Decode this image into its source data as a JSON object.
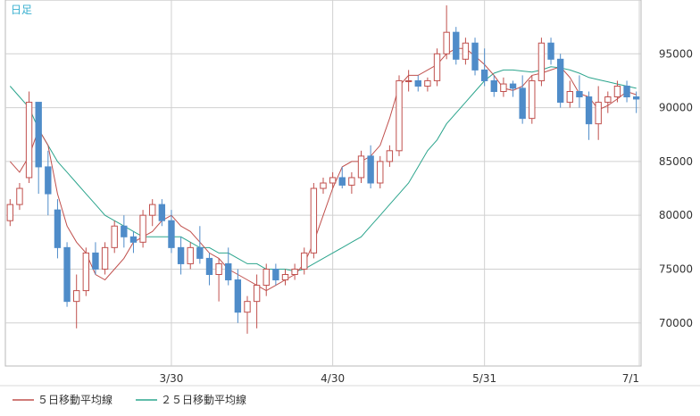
{
  "chart_data": {
    "type": "candlestick",
    "period_label": "日足",
    "legend": [
      {
        "label": "５日移動平均線",
        "color": "#c0504d"
      },
      {
        "label": "２５日移動平均線",
        "color": "#2ca58d"
      }
    ],
    "x_ticks": [
      "3/30",
      "4/30",
      "5/31",
      "7/1"
    ],
    "y_ticks": [
      70000,
      75000,
      80000,
      85000,
      90000,
      95000
    ],
    "ylim": [
      66000,
      100000
    ],
    "colors": {
      "up": "#c0504d",
      "down": "#4f8cc9",
      "ma5": "#c0504d",
      "ma25": "#2ca58d",
      "grid": "#d0d0d0",
      "axis_text": "#333333",
      "title": "#3ab0d0"
    },
    "candles": [
      [
        79500,
        81500,
        79000,
        81000
      ],
      [
        81000,
        83000,
        80500,
        82500
      ],
      [
        83500,
        91500,
        83000,
        90500
      ],
      [
        90500,
        90500,
        82000,
        84500
      ],
      [
        84500,
        86000,
        80000,
        82000
      ],
      [
        80500,
        81500,
        76000,
        77000
      ],
      [
        77000,
        77500,
        71500,
        72000
      ],
      [
        72000,
        74500,
        69500,
        73000
      ],
      [
        73000,
        77000,
        72500,
        76500
      ],
      [
        76500,
        77500,
        74500,
        75000
      ],
      [
        75000,
        77500,
        74500,
        77000
      ],
      [
        77000,
        79500,
        76500,
        79000
      ],
      [
        79000,
        80000,
        77000,
        78000
      ],
      [
        78000,
        78500,
        76500,
        77500
      ],
      [
        77500,
        80500,
        77000,
        80000
      ],
      [
        80000,
        81500,
        79000,
        81000
      ],
      [
        81000,
        81500,
        79000,
        79500
      ],
      [
        79500,
        80500,
        76500,
        77000
      ],
      [
        77000,
        78000,
        74500,
        75500
      ],
      [
        75500,
        77500,
        75000,
        77000
      ],
      [
        77000,
        79000,
        75500,
        76000
      ],
      [
        76000,
        76500,
        73500,
        74500
      ],
      [
        74500,
        76000,
        72000,
        75500
      ],
      [
        75500,
        77000,
        73500,
        74000
      ],
      [
        74000,
        75000,
        70000,
        71000
      ],
      [
        71000,
        72500,
        69000,
        72000
      ],
      [
        72000,
        74500,
        69500,
        73500
      ],
      [
        73500,
        75500,
        72500,
        75000
      ],
      [
        75000,
        75500,
        73500,
        74000
      ],
      [
        74000,
        75000,
        73500,
        74500
      ],
      [
        74500,
        75500,
        74000,
        75000
      ],
      [
        75000,
        77000,
        74500,
        76500
      ],
      [
        76500,
        83000,
        76000,
        82500
      ],
      [
        82500,
        83500,
        82000,
        83000
      ],
      [
        83000,
        84000,
        82500,
        83500
      ],
      [
        83500,
        84500,
        82500,
        82800
      ],
      [
        82800,
        84000,
        82000,
        83500
      ],
      [
        83500,
        86000,
        83000,
        85500
      ],
      [
        85500,
        86500,
        82500,
        83000
      ],
      [
        83000,
        85500,
        82500,
        85000
      ],
      [
        85000,
        86500,
        84500,
        86000
      ],
      [
        86000,
        93000,
        85500,
        92500
      ],
      [
        92500,
        93500,
        91500,
        92500
      ],
      [
        92500,
        93000,
        91500,
        92000
      ],
      [
        92000,
        92800,
        91500,
        92500
      ],
      [
        92500,
        95500,
        92000,
        95000
      ],
      [
        95000,
        99500,
        94500,
        97000
      ],
      [
        97000,
        97500,
        94000,
        94500
      ],
      [
        94500,
        96500,
        94000,
        96000
      ],
      [
        96000,
        96500,
        93000,
        93500
      ],
      [
        93500,
        95500,
        92000,
        92500
      ],
      [
        92500,
        93000,
        91000,
        91500
      ],
      [
        91500,
        92800,
        91000,
        92200
      ],
      [
        92200,
        92500,
        91000,
        91800
      ],
      [
        91800,
        93000,
        88500,
        89000
      ],
      [
        89000,
        93000,
        88500,
        92500
      ],
      [
        92500,
        96500,
        92000,
        96000
      ],
      [
        96000,
        96500,
        94000,
        94500
      ],
      [
        94500,
        95000,
        90000,
        90500
      ],
      [
        90500,
        92500,
        90000,
        91500
      ],
      [
        91500,
        93000,
        90000,
        91000
      ],
      [
        91000,
        91500,
        87000,
        88500
      ],
      [
        88500,
        92000,
        87000,
        90500
      ],
      [
        90500,
        91500,
        89500,
        91000
      ],
      [
        91000,
        92500,
        90500,
        92000
      ],
      [
        92000,
        92500,
        90500,
        91000
      ],
      [
        91000,
        91500,
        89500,
        90800
      ]
    ],
    "ma5": [
      85000,
      84000,
      85500,
      88000,
      86500,
      82000,
      79000,
      77500,
      76500,
      74500,
      74000,
      75000,
      76000,
      77500,
      78000,
      78500,
      79500,
      80000,
      79000,
      78500,
      77500,
      76500,
      76000,
      75000,
      74500,
      74000,
      73500,
      73000,
      73500,
      74000,
      74500,
      75500,
      77500,
      80000,
      82500,
      84500,
      85000,
      85000,
      85500,
      86500,
      89000,
      92000,
      93000,
      93000,
      93500,
      94000,
      95000,
      95500,
      95500,
      94800,
      94000,
      93000,
      91800,
      91600,
      92000,
      93000,
      93200,
      93500,
      93800,
      92800,
      91300,
      91000,
      89800,
      90200,
      90800,
      91500,
      91200
    ],
    "ma25": [
      92000,
      91000,
      90000,
      88000,
      86500,
      85000,
      84000,
      83000,
      82000,
      81000,
      80000,
      79500,
      79000,
      78500,
      78000,
      78000,
      78000,
      78000,
      78000,
      77500,
      77000,
      77000,
      76500,
      76500,
      76000,
      75500,
      75500,
      75000,
      75000,
      75000,
      74800,
      75000,
      75500,
      76000,
      76500,
      77000,
      77500,
      78000,
      79000,
      80000,
      81000,
      82000,
      83000,
      84500,
      86000,
      87000,
      88500,
      89500,
      90500,
      91500,
      92500,
      93200,
      93500,
      93500,
      93400,
      93300,
      93500,
      93800,
      93700,
      93500,
      93200,
      92800,
      92600,
      92400,
      92200,
      92000,
      91800
    ]
  }
}
